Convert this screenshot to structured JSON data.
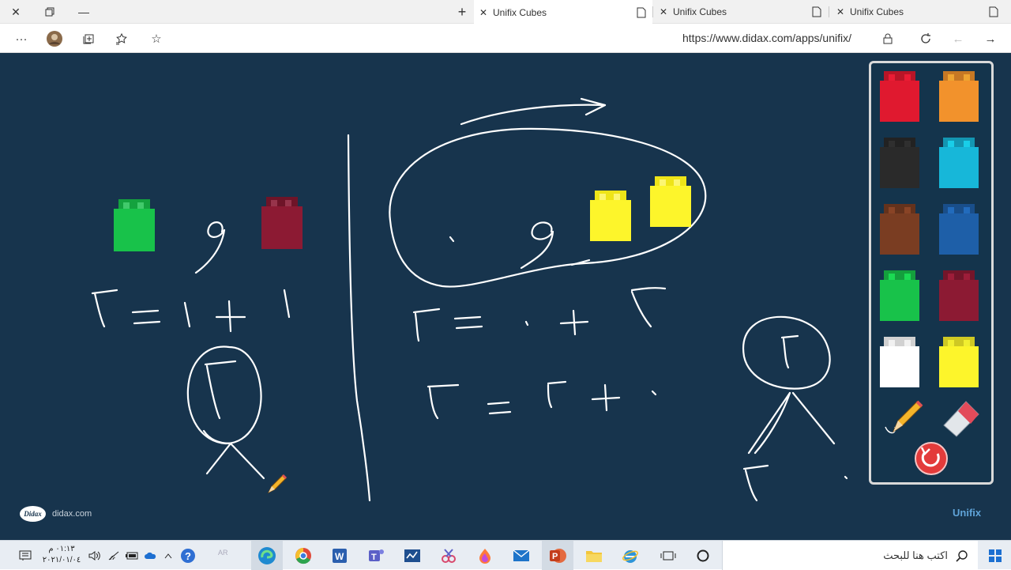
{
  "browser": {
    "tabs": [
      {
        "title": "Unifix Cubes",
        "active": true
      },
      {
        "title": "Unifix Cubes",
        "active": false
      },
      {
        "title": "Unifix Cubes",
        "active": false
      }
    ],
    "url": "https://www.didax.com/apps/unifix/"
  },
  "canvas": {
    "background": "#17344d",
    "cubes_on_board": [
      {
        "color": "#18c24a",
        "label": "green"
      },
      {
        "color": "#8c1a33",
        "label": "maroon"
      },
      {
        "color": "#fdf52b",
        "label": "yellow"
      },
      {
        "color": "#fdf52b",
        "label": "yellow"
      }
    ],
    "footer_site": "didax.com",
    "footer_badge": "Didax",
    "brand": "Unifix"
  },
  "palette": {
    "colors": [
      "#e0192f",
      "#f2922c",
      "#2a2a2a",
      "#17b7d9",
      "#7a3d22",
      "#1e5fa8",
      "#18c24a",
      "#8c1a33",
      "#ffffff",
      "#fdf52b"
    ],
    "tools": [
      "pencil-tool",
      "eraser-tool",
      "reset-button"
    ]
  },
  "taskbar": {
    "clock_time": "٠١:١٣ م",
    "clock_date": "٢٠٢١/٠١/٠٤",
    "language": "AR",
    "search_placeholder": "اكتب هنا للبحث"
  }
}
